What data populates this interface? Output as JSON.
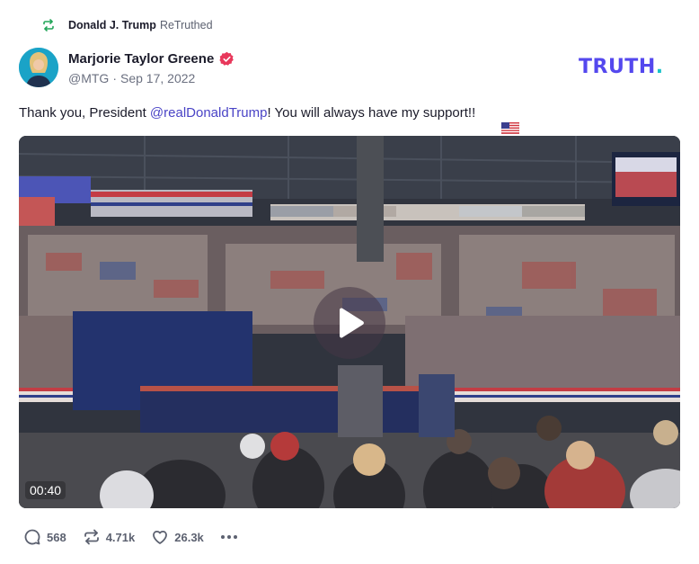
{
  "retruth": {
    "author": "Donald J. Trump",
    "label": "ReTruthed",
    "icon": "retruth-icon"
  },
  "post": {
    "author_name": "Marjorie Taylor Greene",
    "verified_icon": "verified-badge-icon",
    "handle": "@MTG",
    "separator": "·",
    "date": "Sep 17, 2022",
    "text_prefix": "Thank you, President ",
    "mention": "@realDonaldTrump",
    "text_suffix": "! You will always have my support!!",
    "flag_icon": "us-flag-icon"
  },
  "brand": {
    "logo_text": "TRUTH",
    "logo_dot": ".",
    "logo_color": "#5448ee",
    "dot_color": "#19c3c9"
  },
  "video": {
    "duration": "00:40",
    "play_icon": "play-icon"
  },
  "actions": {
    "replies": "568",
    "retruths": "4.71k",
    "likes": "26.3k",
    "reply_icon": "reply-icon",
    "retruth_icon": "retruth-icon",
    "like_icon": "heart-icon",
    "more_icon": "more-icon"
  },
  "colors": {
    "accent": "#5448ee",
    "mention": "#4a44c6",
    "verified": "#e8385b",
    "retruth_green": "#22a559"
  }
}
